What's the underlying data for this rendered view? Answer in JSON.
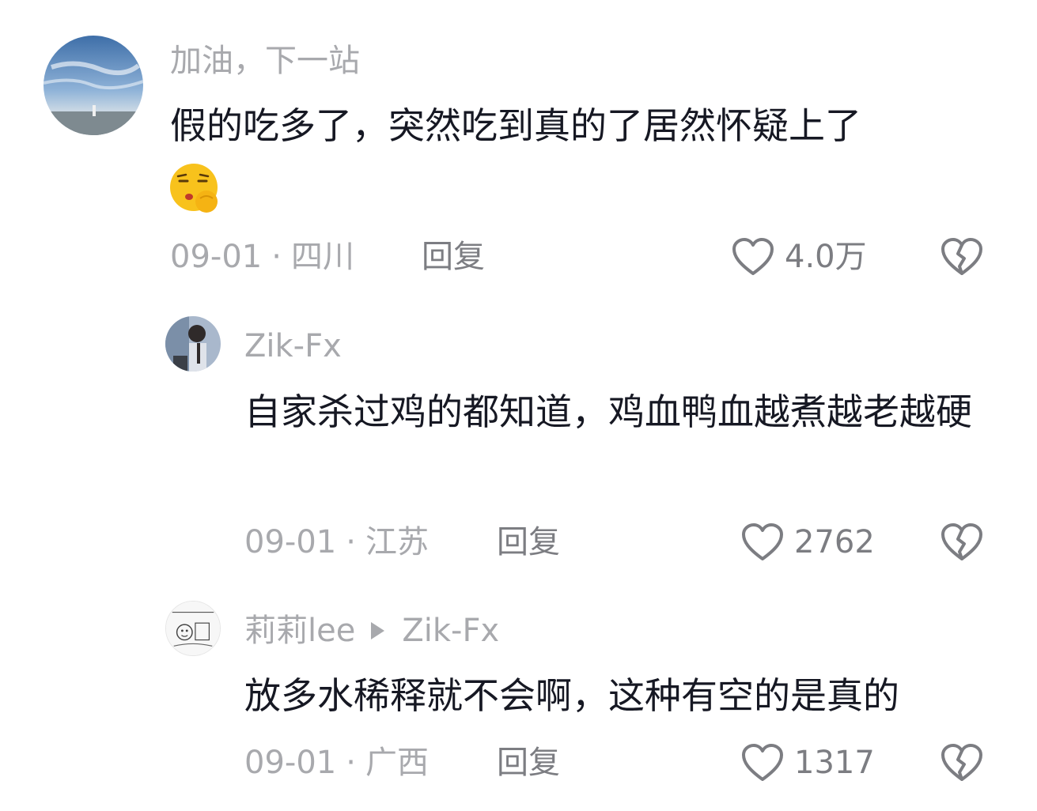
{
  "comments": [
    {
      "author": "加油，下一站",
      "text": "假的吃多了，突然吃到真的了居然怀疑上了",
      "emoji": "sleepy-wink-emoji",
      "date": "09-01",
      "location": "四川",
      "reply_label": "回复",
      "likes": "4.0万"
    },
    {
      "author": "Zik-Fx",
      "text": "自家杀过鸡的都知道，鸡血鸭血越煮越老越硬",
      "date": "09-01",
      "location": "江苏",
      "reply_label": "回复",
      "likes": "2762"
    },
    {
      "author": "莉莉lee",
      "reply_to": "Zik-Fx",
      "text": "放多水稀释就不会啊，这种有空的是真的",
      "date": "09-01",
      "location": "广西",
      "reply_label": "回复",
      "likes": "1317"
    }
  ],
  "separator": "·",
  "colors": {
    "primary_text": "#161823",
    "secondary_text": "#a8a9ad",
    "action_text": "#7c7d82"
  }
}
